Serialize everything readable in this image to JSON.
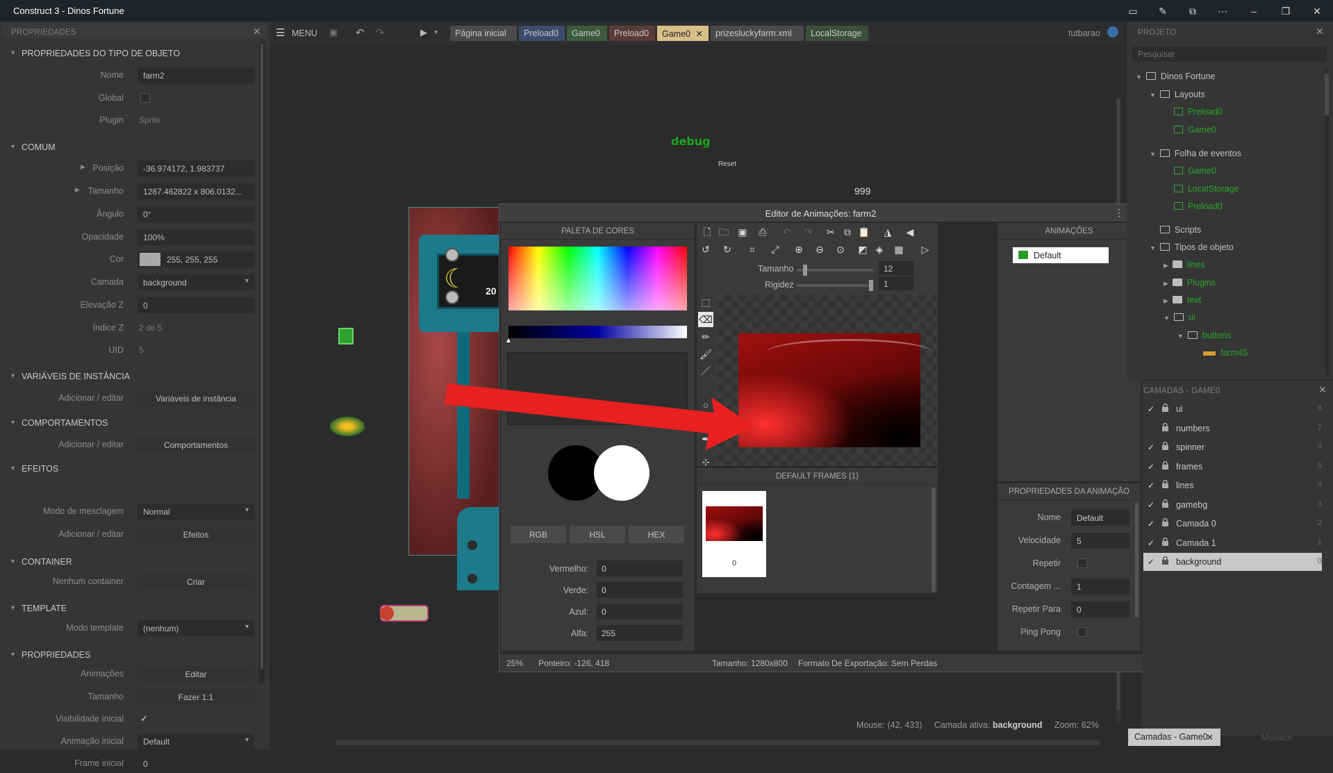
{
  "window": {
    "title": "Construct 3 - Dinos Fortune"
  },
  "properties": {
    "header": "PROPRIEDADES",
    "sections": {
      "object_type": "PROPRIEDADES DO TIPO DE OBJETO",
      "common": "COMUM",
      "instance_vars": "VARIÁVEIS DE INSTÂNCIA",
      "behaviors": "COMPORTAMENTOS",
      "effects": "EFEITOS",
      "container": "CONTAINER",
      "template": "TEMPLATE",
      "properties": "PROPRIEDADES"
    },
    "rows": {
      "name_label": "Nome",
      "name_value": "farm2",
      "global_label": "Global",
      "plugin_label": "Plugin",
      "plugin_value": "Sprite",
      "position_label": "Posição",
      "position_value": "-36.974172, 1.983737",
      "size_label": "Tamanho",
      "size_value": "1287.462822  x 806.0132...",
      "angle_label": "Ângulo",
      "angle_value": "0°",
      "opacity_label": "Opacidade",
      "opacity_value": "100%",
      "color_label": "Cor",
      "color_value": "255, 255, 255",
      "layer_label": "Camada",
      "layer_value": "background",
      "zelev_label": "Elevação Z",
      "zelev_value": "0",
      "zindex_label": "Índice Z",
      "zindex_value": "2 de 5",
      "uid_label": "UID",
      "uid_value": "5",
      "ivars_label": "Adicionar / editar",
      "ivars_button": "Variáveis de instância",
      "beh_label": "Adicionar / editar",
      "beh_button": "Comportamentos",
      "blend_label": "Modo de mesclagem",
      "blend_value": "Normal",
      "fx_label": "Adicionar / editar",
      "fx_button": "Efeitos",
      "cont_label": "Nenhum container",
      "cont_button": "Criar",
      "tmpl_label": "Modo template",
      "tmpl_value": "(nenhum)",
      "anim_label": "Animações",
      "anim_button": "Editar",
      "size2_label": "Tamanho",
      "size2_button": "Fazer 1:1",
      "vis_label": "Visibilidade inicial",
      "initanim_label": "Animação inicial",
      "initanim_value": "Default",
      "initframe_label": "Frame inicial",
      "initframe_value": "0"
    }
  },
  "toolbar": {
    "menu": "MENU",
    "user": "tutbarao"
  },
  "tabs": [
    {
      "label": "Página inicial",
      "color": "#4a4a4a"
    },
    {
      "label": "Preload0",
      "color": "#3b4b6b"
    },
    {
      "label": "Game0",
      "color": "#3c5a3c"
    },
    {
      "label": "Preload0",
      "color": "#5a3a3a"
    },
    {
      "label": "Game0",
      "color": "#d8c089",
      "active": true
    },
    {
      "label": "prizesluckyfarm.xml",
      "color": "#4a4a4a"
    },
    {
      "label": "LocalStorage",
      "color": "#3c4f3c"
    }
  ],
  "canvas": {
    "debug": "debug",
    "reset": "Reset",
    "counter": "999",
    "banana_num": "20",
    "status_mouse": "Mouse: (42, 433)",
    "status_layer_prefix": "Camada ativa:",
    "status_layer": "background",
    "status_zoom": "Zoom: 62%"
  },
  "dialog": {
    "title": "Editor de Animações: farm2",
    "palette_header": "PALETA DE CORES",
    "color_modes": [
      "RGB",
      "HSL",
      "HEX"
    ],
    "red_label": "Vermelho:",
    "red": "0",
    "green_label": "Verde:",
    "green": "0",
    "blue_label": "Azul:",
    "blue": "0",
    "alpha_label": "Alfa:",
    "alpha": "255",
    "brush_size_label": "Tamanho",
    "brush_size": "12",
    "hardness_label": "Rigidez",
    "hardness": "1",
    "brush_size_level": 0.09,
    "hardness_level": 1.0,
    "frames_header": "DEFAULT FRAMES (1)",
    "frame_index": "0",
    "animations_header": "ANIMAÇÕES",
    "animation_default": "Default",
    "anim_props_header": "PROPRIEDADES DA ANIMAÇÃO",
    "ap": {
      "name_label": "Nome",
      "name": "Default",
      "speed_label": "Velocidade",
      "speed": "5",
      "loop_label": "Repetir",
      "count_label": "Contagem ...",
      "count": "1",
      "repeat_to_label": "Repetir Para",
      "repeat_to": "0",
      "pingpong_label": "Ping Pong"
    },
    "status": {
      "zoom": "25%",
      "pointer": "Ponteiro: -126, 418",
      "size": "Tamanho: 1280x800",
      "export": "Formato De Exportação: Sem Perdas"
    }
  },
  "project": {
    "header": "PROJETO",
    "search_placeholder": "Pesquisar",
    "items": {
      "root": "Dinos Fortune",
      "layouts": "Layouts",
      "lay1": "Preload0",
      "lay2": "Game0",
      "events": "Folha de eventos",
      "ev1": "Game0",
      "ev2": "LocalStorage",
      "ev3": "Preload0",
      "scripts": "Scripts",
      "types": "Tipos de objeto",
      "f1": "lines",
      "f2": "Plugins",
      "f3": "text",
      "f4": "ui",
      "f5": "buttons",
      "o1": "farm45"
    }
  },
  "layers": {
    "header": "CAMADAS - GAME0",
    "items": [
      {
        "name": "ui",
        "index": "8",
        "checked": true
      },
      {
        "name": "numbers",
        "index": "7",
        "checked": false
      },
      {
        "name": "spinner",
        "index": "6",
        "checked": true
      },
      {
        "name": "frames",
        "index": "5",
        "checked": true
      },
      {
        "name": "lines",
        "index": "4",
        "checked": true
      },
      {
        "name": "gamebg",
        "index": "3",
        "checked": true
      },
      {
        "name": "Camada 0",
        "index": "2",
        "checked": true
      },
      {
        "name": "Camada 1",
        "index": "1",
        "checked": true
      },
      {
        "name": "background",
        "index": "0",
        "checked": true,
        "selected": true
      }
    ],
    "bottom_tab": "Camadas - Game0",
    "bottom_tab2": "Mosaico"
  }
}
